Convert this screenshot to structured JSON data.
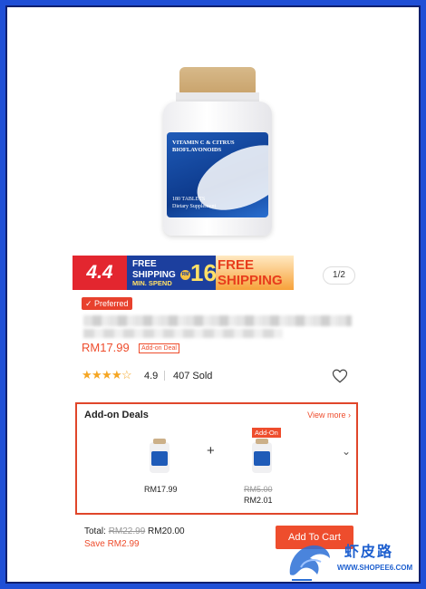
{
  "product_image": {
    "label_line1": "VITAMIN C & CITRUS",
    "label_line2": "BIOFLAVONOIDS",
    "label_line3": "180 TABLETS",
    "label_line4": "Dietary Supplement"
  },
  "banner": {
    "promo": "4.4",
    "free_line1": "FREE",
    "free_line2": "SHIPPING",
    "min_spend": "MIN. SPEND",
    "rm": "RM",
    "amount": "16",
    "ship_line1": "FREE",
    "ship_line2": "SHIPPING"
  },
  "pager": "1/2",
  "product": {
    "preferred": "Preferred",
    "price": "RM17.99",
    "addon_tag": "Add-on Deal",
    "rating_value": 4.5,
    "rating": "4.9",
    "sold": "407 Sold"
  },
  "deals": {
    "title": "Add-on Deals",
    "view_more": "View more",
    "item1_price": "RM17.99",
    "item2_tag": "Add-On",
    "item2_old_price": "RM5.00",
    "item2_price": "RM2.01",
    "plus": "+"
  },
  "footer": {
    "total_label": "Total:",
    "total_old": "RM22.99",
    "total_new": "RM20.00",
    "save_label": "Save",
    "save_amount": "RM2.99",
    "cart_button": "Add To Cart"
  },
  "watermark": {
    "cn": "虾皮路",
    "url": "WWW.SHOPEE6.COM"
  },
  "colors": {
    "accent": "#ee4d2d",
    "star": "#f5a623",
    "frame": "#1f4fd6"
  }
}
